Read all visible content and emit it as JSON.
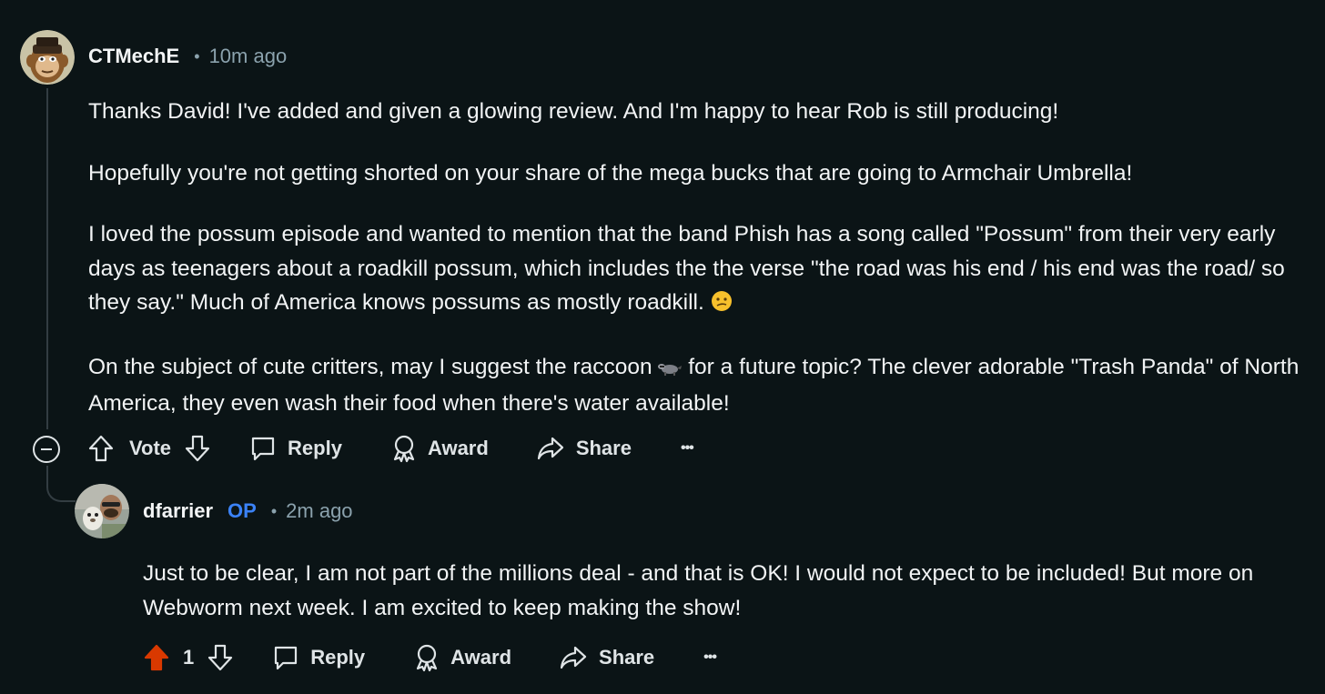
{
  "comments": [
    {
      "username": "CTMechE",
      "timestamp": "10m ago",
      "paragraphs": [
        "Thanks David! I've added and given a glowing review. And I'm happy to hear Rob is still producing!",
        "Hopefully you're not getting shorted on your share of the mega bucks that are going to Armchair Umbrella!",
        "I loved the possum episode and wanted to mention that the band Phish has a song called \"Possum\" from their very early days as teenagers about a roadkill possum, which includes the the verse \"the road was his end / his end was the road/ so they say.\" Much of America knows possums as mostly roadkill.",
        "On the subject of cute critters, may I suggest the raccoon",
        "for a future topic? The clever adorable \"Trash Panda\" of North America, they even wash their food when there's water available!"
      ],
      "emojis": [
        "confused-face",
        "raccoon"
      ],
      "actions": {
        "vote_label": "Vote",
        "reply_label": "Reply",
        "award_label": "Award",
        "share_label": "Share",
        "more_label": "•••"
      }
    },
    {
      "username": "dfarrier",
      "op_tag": "OP",
      "timestamp": "2m ago",
      "paragraphs": [
        "Just to be clear, I am not part of the millions deal - and that is OK! I would not expect to be included! But more on Webworm next week. I am excited to keep making the show!"
      ],
      "actions": {
        "vote_count": "1",
        "upvoted": true,
        "reply_label": "Reply",
        "award_label": "Award",
        "share_label": "Share",
        "more_label": "•••"
      }
    }
  ],
  "colors": {
    "background": "#0b1416",
    "text": "#f2f4f5",
    "meta": "#8ba2ad",
    "op": "#3b82f6",
    "upvote": "#d93900",
    "thread_line": "#333d42"
  },
  "dot_separator": "•"
}
